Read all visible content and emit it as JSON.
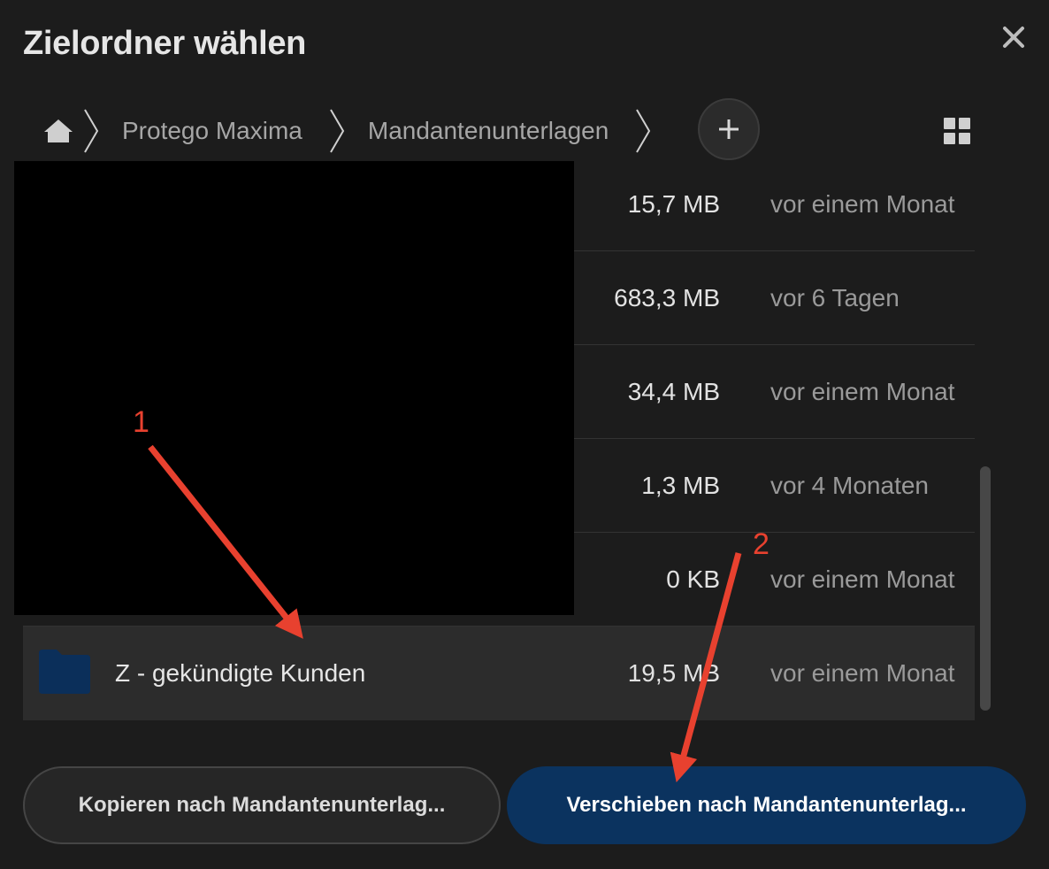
{
  "dialog": {
    "title": "Zielordner wählen",
    "close_icon": "close-icon"
  },
  "breadcrumb": {
    "home_icon": "home-icon",
    "items": [
      "Protego Maxima",
      "Mandantenunterlagen"
    ]
  },
  "toolbar": {
    "add_icon": "plus-icon",
    "view_icon": "grid-view-icon"
  },
  "files": [
    {
      "name": "",
      "size": "15,7 MB",
      "modified": "vor einem Monat"
    },
    {
      "name": "",
      "size": "683,3 MB",
      "modified": "vor 6 Tagen"
    },
    {
      "name": "",
      "size": "34,4 MB",
      "modified": "vor einem Monat"
    },
    {
      "name": "",
      "size": "1,3 MB",
      "modified": "vor 4 Monaten"
    },
    {
      "name": "",
      "size": "0 KB",
      "modified": "vor einem Monat"
    },
    {
      "name": "Z - gekündigte Kunden",
      "size": "19,5 MB",
      "modified": "vor einem Monat",
      "selected": true,
      "icon": "folder-icon"
    }
  ],
  "buttons": {
    "copy_label": "Kopieren nach Mandantenunterlag...",
    "move_label": "Verschieben nach Mandantenunterlag..."
  },
  "annotations": [
    {
      "label": "1"
    },
    {
      "label": "2"
    }
  ],
  "colors": {
    "background": "#1c1c1c",
    "primary_button": "#0b335f",
    "folder": "#0b2f5a",
    "annotation": "#e8412f"
  }
}
